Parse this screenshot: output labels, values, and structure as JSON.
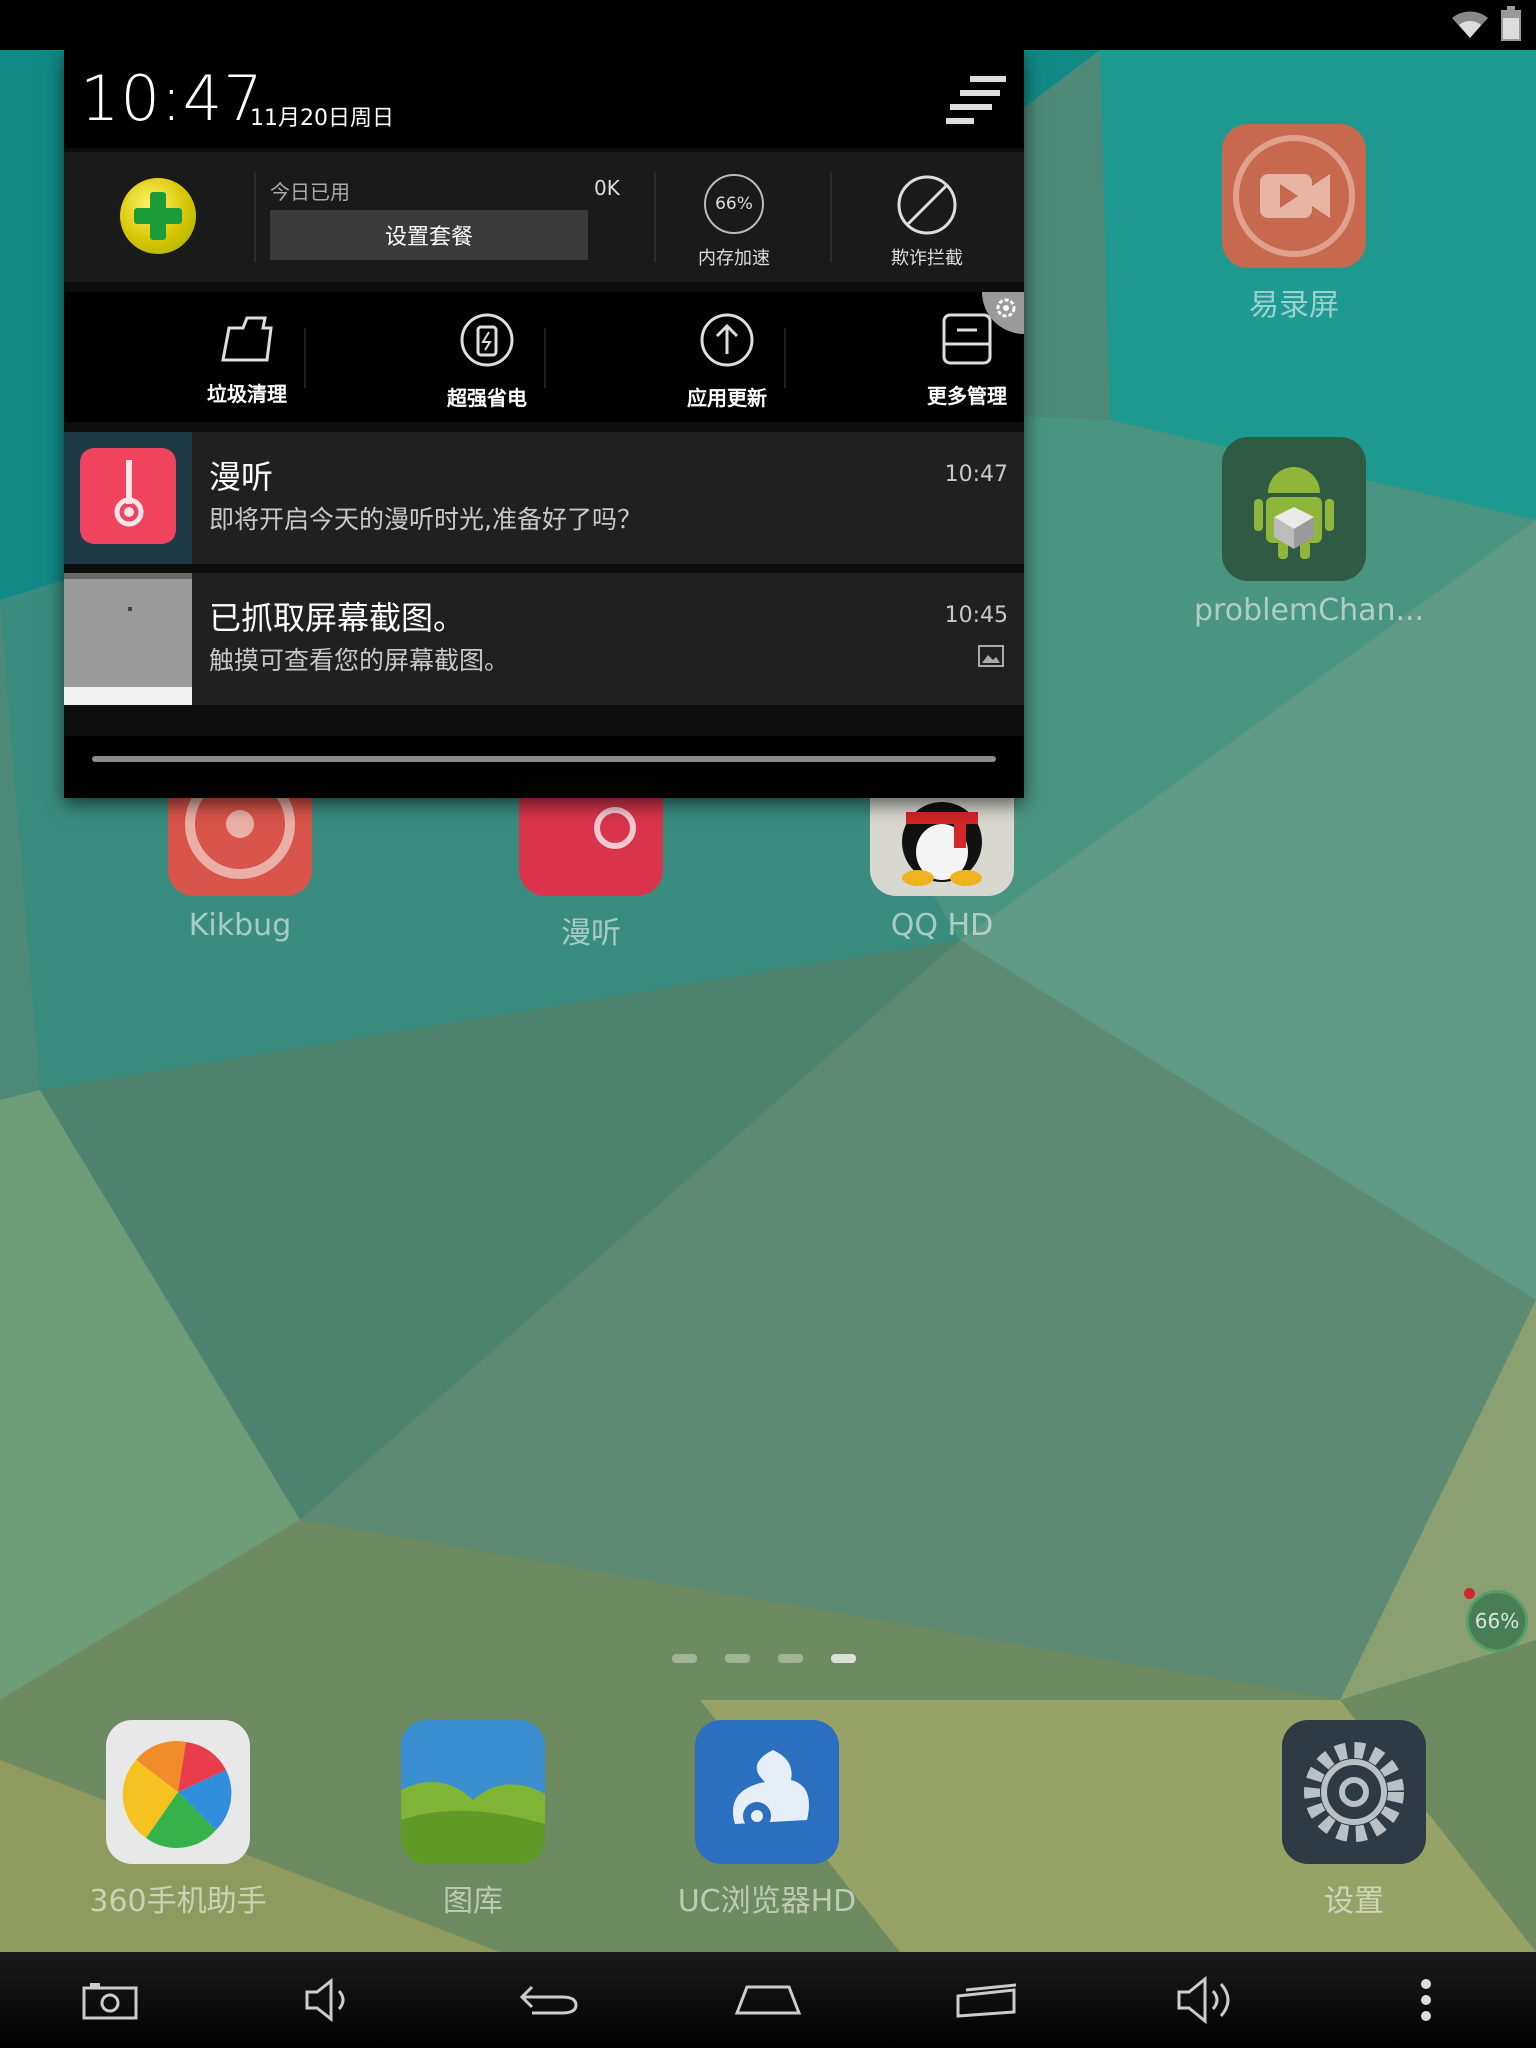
{
  "colors": {
    "shade_bg": "#0d0d0d",
    "notif_bg": "#202020",
    "manting_red": "#f0445e",
    "wallpaper_teal": "#1b8f8a",
    "wallpaper_olive": "#9ea36a"
  },
  "status_bar": {
    "icons": [
      "wifi-icon",
      "battery-icon"
    ]
  },
  "shade": {
    "clock": "10:47",
    "date": "11月20日周日",
    "panel360": {
      "used_label": "今日已用",
      "used_value": "0K",
      "plan_button": "设置套餐",
      "memory_percent": "66%",
      "memory_label": "内存加速",
      "block_label": "欺诈拦截"
    },
    "tools": [
      {
        "label": "垃圾清理",
        "icon": "cleanup-folder-icon"
      },
      {
        "label": "超强省电",
        "icon": "power-save-icon"
      },
      {
        "label": "应用更新",
        "icon": "update-arrow-icon"
      },
      {
        "label": "更多管理",
        "icon": "more-manage-icon"
      }
    ],
    "notifications": [
      {
        "title": "漫听",
        "text": "即将开启今天的漫听时光,准备好了吗？",
        "time": "10:47"
      },
      {
        "title": "已抓取屏幕截图。",
        "text": "触摸可查看您的屏幕截图。",
        "time": "10:45"
      }
    ]
  },
  "home": {
    "apps": [
      {
        "label": "易录屏",
        "icon": "screen-recorder-icon"
      },
      {
        "label": "problemChan...",
        "icon": "android-robot-icon"
      },
      {
        "label": "Kikbug",
        "icon": "kikbug-icon"
      },
      {
        "label": "漫听",
        "icon": "manting-headphone-icon"
      },
      {
        "label": "QQ HD",
        "icon": "qq-penguin-icon"
      }
    ],
    "page_indicator": {
      "count": 4,
      "active": 4
    },
    "memory_bubble": "66%",
    "dock": [
      {
        "label": "360手机助手",
        "icon": "360-assistant-icon"
      },
      {
        "label": "图库",
        "icon": "gallery-icon"
      },
      {
        "label": "UC浏览器HD",
        "icon": "uc-browser-icon"
      },
      {
        "label": "设置",
        "icon": "settings-gear-icon"
      }
    ]
  },
  "nav_bar": {
    "buttons": [
      "screenshot-camera-icon",
      "volume-down-icon",
      "back-icon",
      "home-icon",
      "recent-apps-icon",
      "volume-up-icon",
      "menu-dots-icon"
    ]
  }
}
